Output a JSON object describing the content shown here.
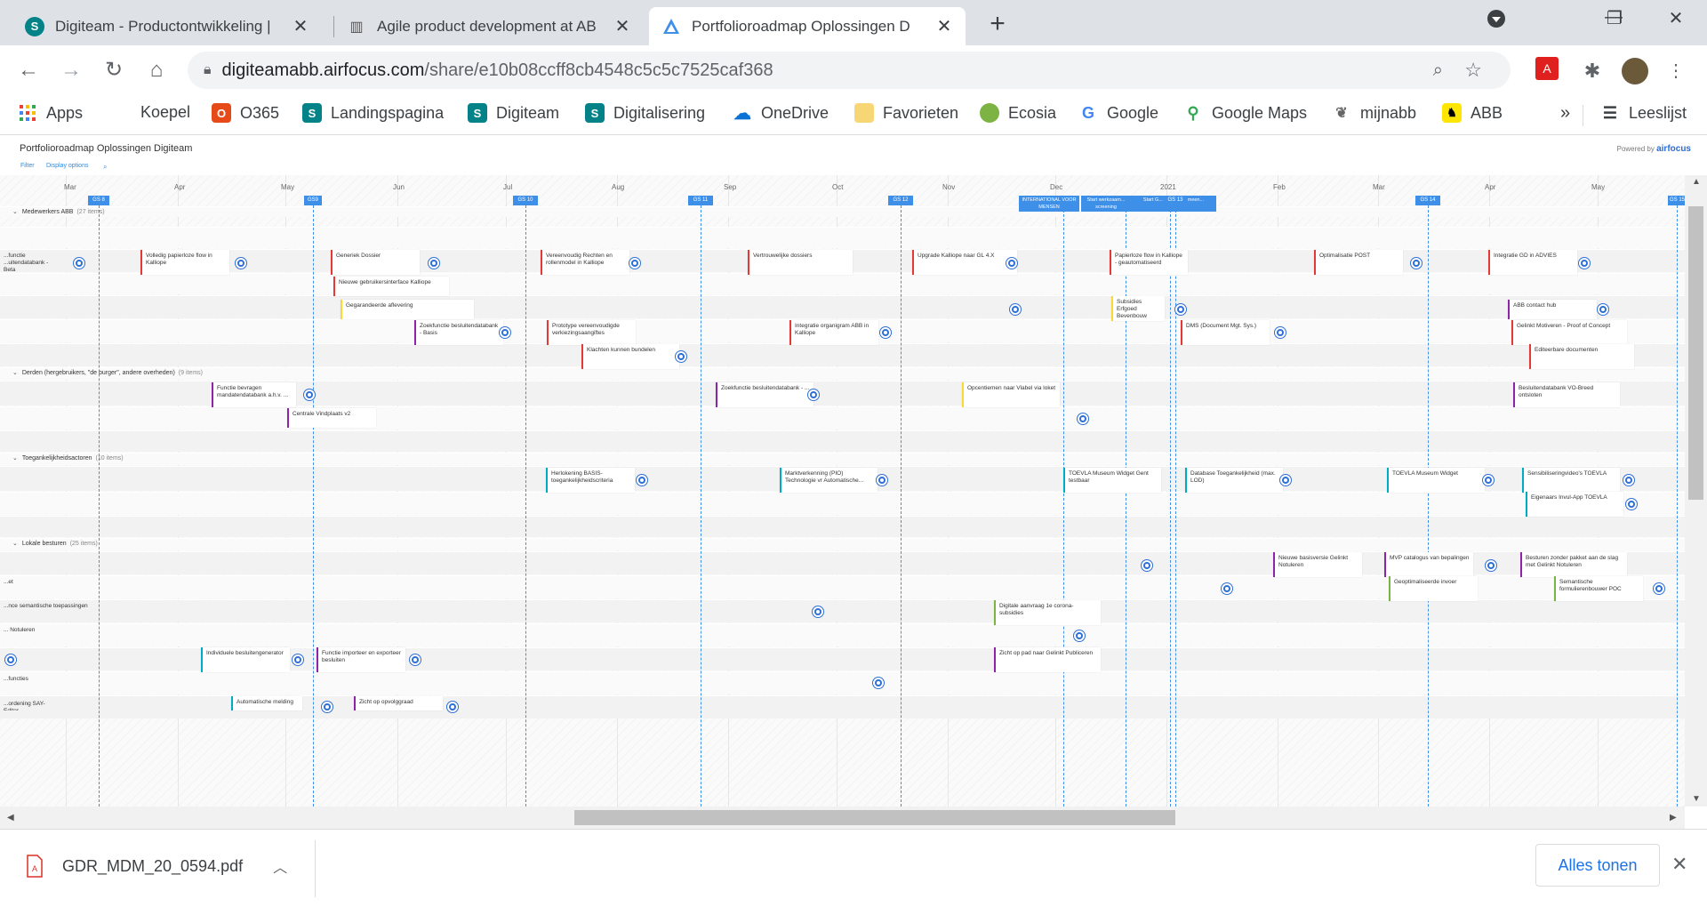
{
  "browser": {
    "tabs": [
      {
        "title": "Digiteam - Productontwikkeling |",
        "icon": "sharepoint-icon",
        "close": "✕"
      },
      {
        "title": "Agile product development at AB",
        "icon": "book-icon",
        "close": "✕"
      },
      {
        "title": "Portfolioroadmap Oplossingen D",
        "icon": "airfocus-icon",
        "close": "✕"
      }
    ],
    "new_tab": "+",
    "url_host": "digiteamabb.airfocus.com",
    "url_path": "/share/e10b08ccff8cb4548c5c5c7525caf368",
    "bookmarks": [
      {
        "label": "Apps",
        "icon": "apps-grid-icon"
      },
      {
        "label": "Koepel",
        "icon": "none"
      },
      {
        "label": "O365",
        "icon": "office-icon"
      },
      {
        "label": "Landingspagina",
        "icon": "sharepoint-icon"
      },
      {
        "label": "Digiteam",
        "icon": "sharepoint-icon"
      },
      {
        "label": "Digitalisering",
        "icon": "sharepoint-icon"
      },
      {
        "label": "OneDrive",
        "icon": "onedrive-icon"
      },
      {
        "label": "Favorieten",
        "icon": "folder-icon"
      },
      {
        "label": "Ecosia",
        "icon": "ecosia-icon"
      },
      {
        "label": "Google",
        "icon": "google-icon"
      },
      {
        "label": "Google Maps",
        "icon": "maps-pin-icon"
      },
      {
        "label": "mijnabb",
        "icon": "mijnabb-icon"
      },
      {
        "label": "ABB",
        "icon": "abb-lion-icon"
      }
    ],
    "bookmarks_more": "»",
    "reading_list": "Leeslijst"
  },
  "roadmap": {
    "title": "Portfolioroadmap Oplossingen Digiteam",
    "powered_by": "Powered by",
    "brand": "airfocus",
    "filter_label": "Filter",
    "display_options_label": "Display options",
    "months": [
      "Mar",
      "Apr",
      "May",
      "Jun",
      "Jul",
      "Aug",
      "Sep",
      "Oct",
      "Nov",
      "Dec",
      "2021",
      "Feb",
      "Mar",
      "Apr",
      "May"
    ],
    "milestones": [
      "GS 8",
      "GS9",
      "GS 10",
      "GS 11",
      "GS 12",
      "INTERNATIONAL VOOR MENSEN",
      "Start werkzaam... screening",
      "Start G... ...ander gemeen...",
      "GS 13",
      "GS 14",
      "GS 15"
    ],
    "groups": [
      {
        "name": "Medewerkers ABB",
        "count": "(27 items)"
      },
      {
        "name": "Derden (hergebruikers, \"de burger\", andere overheden)",
        "count": "(9 items)"
      },
      {
        "name": "Toegankelijkheidsactoren",
        "count": "(10 items)"
      },
      {
        "name": "Lokale besturen",
        "count": "(25 items)"
      }
    ],
    "items": [
      "...functie ...uitendatabank - Beta",
      "Volledig papierloze flow in Kalliope",
      "Generiek Dossier",
      "Vereenvoudig Rechten en rollenmodel in Kalliope",
      "Vertrouwelijke dossiers",
      "Upgrade Kalliope naar GL 4.X",
      "Papierloze flow in Kalliope - geautomatiseerd",
      "Optimalisatie POST",
      "Integratie GD in ADVIES",
      "Nieuwe gebruikersinterface Kalliope",
      "Gegarandeerde aflevering",
      "Subsidies Erfgoed Bevenbouw",
      "ABB contact hub",
      "Zoekfunctie besluitendatabank - Basis",
      "Prototype vereenvoudigde verkiezingsaangiftes",
      "Integratie organigram ABB in Kalliope",
      "DMS (Document Mgt. Sys.)",
      "Gelinkt Motiveren - Proof of Concept",
      "Klachten kunnen bundelen",
      "Editeerbare documenten",
      "Functie bevragen mandatendatabank a.h.v. ...",
      "Zoekfunctie besluitendatabank - ...",
      "Opcentiemen naar Vlabel via loket",
      "Besluitendatabank VO-Breed ontsloten",
      "Centrale Vindplaats v2",
      "Herlokening BASIS-toegankelijkheidscriteria",
      "Marktverkenning (PIO) Technologie vr Automatische...",
      "TOEVLA Museum Widget Gent testbaar",
      "Database Toegankelijkheid (max. LOD)",
      "TOEVLA Museum Widget",
      "Sensibiliseringvideo's TOEVLA",
      "Eigenaars Invul-App TOEVLA",
      "Nieuwe basisversie Gelinkt Notuleren",
      "MVP catalogus van bepalingen",
      "Besturen zonder pakket aan de slag met Gelinkt Notuleren",
      "...et",
      "Geoptimaliseerde invoer",
      "Semantische formulierenbouwer POC",
      "...nce semantische toepassingen",
      "Digitale aanvraag 1e corona-subsidies",
      "... Notuleren",
      "Individuele besluitengenerator",
      "Functie importeer en exporteer besluiten",
      "Zicht op pad naar Gelinkt Publiceren",
      "...functies",
      "Automatische melding",
      "Zicht op opvolggraad",
      "...ordening SAY-Editor"
    ]
  },
  "downloads": {
    "file": "GDR_MDM_20_0594.pdf",
    "show_all": "Alles tonen",
    "close": "✕"
  },
  "colors": {
    "accent": "#3d8fe8",
    "dot": "#2d6fd6",
    "red_bar": "#e53935",
    "purple_bar": "#8e24aa",
    "cyan_bar": "#00acc1",
    "yellow_bar": "#fdd835",
    "green_bar": "#7cb342"
  }
}
